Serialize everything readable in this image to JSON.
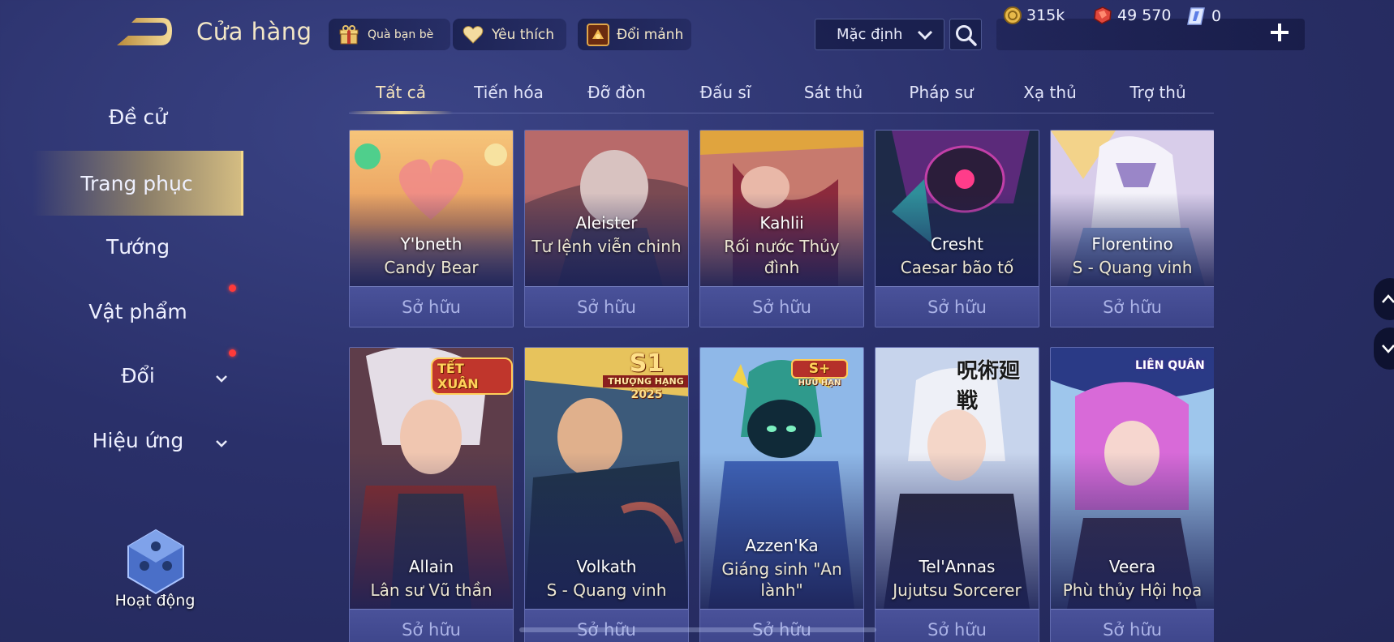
{
  "header": {
    "title": "Cửa hàng",
    "gift_label": "Quà bạn bè",
    "favorite_label": "Yêu thích",
    "exchange_label": "Đổi mảnh",
    "sort_value": "Mặc định",
    "currencies": {
      "gold": "315k",
      "ruby": "49 570",
      "crystal": "0"
    }
  },
  "sidebar": {
    "items": [
      {
        "label": "Đề cử"
      },
      {
        "label": "Trang phục"
      },
      {
        "label": "Tướng"
      },
      {
        "label": "Vật phẩm"
      },
      {
        "label": "Đổi"
      },
      {
        "label": "Hiệu ứng"
      }
    ],
    "activity_label": "Hoạt động"
  },
  "tabs": [
    "Tất cả",
    "Tiến hóa",
    "Đỡ đòn",
    "Đấu sĩ",
    "Sát thủ",
    "Pháp sư",
    "Xạ thủ",
    "Trợ thủ"
  ],
  "owned_label": "Sở hữu",
  "badges": {
    "allain": "TẾT XUÂN",
    "volkath_big": "S1",
    "volkath_small": "THƯỢNG HẠNG",
    "volkath_year": "2025",
    "azzenka_big": "S+",
    "azzenka_small": "HỮU HẠN",
    "telannas": "呪術廻戦",
    "veera": "LIÊN QUÂN"
  },
  "cards": [
    {
      "hero": "Y'bneth",
      "skin": "Candy Bear",
      "art": "candy"
    },
    {
      "hero": "Aleister",
      "skin": "Tư lệnh viễn chinh",
      "art": "aleister"
    },
    {
      "hero": "Kahlii",
      "skin": "Rối nước Thủy đình",
      "art": "kahlii"
    },
    {
      "hero": "Cresht",
      "skin": "Caesar bão tố",
      "art": "cresht"
    },
    {
      "hero": "Florentino",
      "skin": "S - Quang vinh",
      "art": "florentino"
    },
    {
      "hero": "Allain",
      "skin": "Lân sư Vũ thần",
      "art": "allain"
    },
    {
      "hero": "Volkath",
      "skin": "S - Quang vinh",
      "art": "volkath"
    },
    {
      "hero": "Azzen'Ka",
      "skin": "Giáng sinh \"An lành\"",
      "art": "azzenka"
    },
    {
      "hero": "Tel'Annas",
      "skin": "Jujutsu Sorcerer",
      "art": "telannas"
    },
    {
      "hero": "Veera",
      "skin": "Phù thủy Hội họa",
      "art": "veera"
    }
  ]
}
